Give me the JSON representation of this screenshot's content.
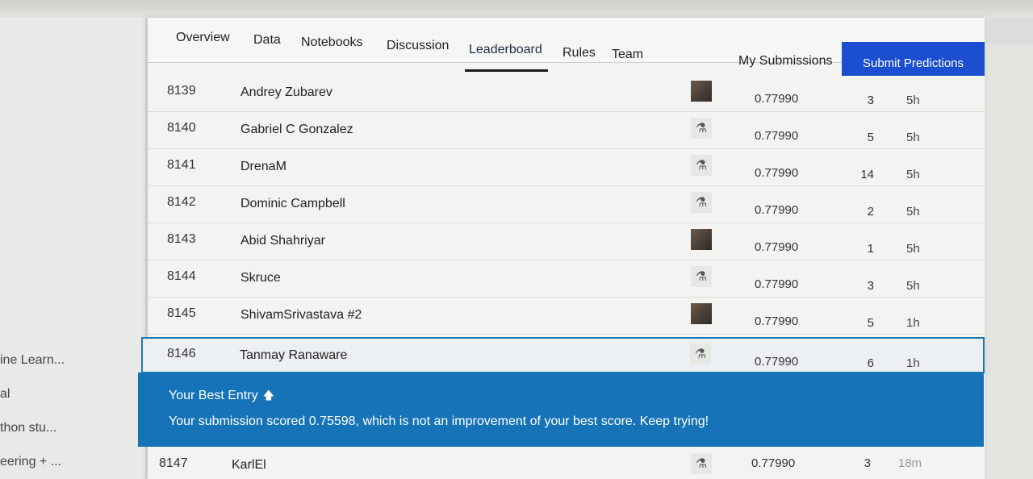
{
  "sidebar": {
    "items": [
      {
        "label": "ine Learn..."
      },
      {
        "label": "al"
      },
      {
        "label": "thon stu..."
      },
      {
        "label": "eering + ..."
      }
    ]
  },
  "tabs": [
    {
      "label": "Overview"
    },
    {
      "label": "Data"
    },
    {
      "label": "Notebooks"
    },
    {
      "label": "Discussion"
    },
    {
      "label": "Leaderboard",
      "active": true
    },
    {
      "label": "Rules"
    },
    {
      "label": "Team"
    }
  ],
  "header": {
    "my_submissions": "My Submissions",
    "submit_label": "Submit Predictions",
    "submit_color": "#1b4fcf"
  },
  "leaderboard": {
    "rows": [
      {
        "rank": "8139",
        "name": "Andrey Zubarev",
        "avatar": "photo",
        "score": "0.77990",
        "entries": "3",
        "last": "5h"
      },
      {
        "rank": "8140",
        "name": "Gabriel C Gonzalez",
        "avatar": "default",
        "score": "0.77990",
        "entries": "5",
        "last": "5h"
      },
      {
        "rank": "8141",
        "name": "DrenaM",
        "avatar": "default",
        "score": "0.77990",
        "entries": "14",
        "last": "5h"
      },
      {
        "rank": "8142",
        "name": "Dominic Campbell",
        "avatar": "default",
        "score": "0.77990",
        "entries": "2",
        "last": "5h"
      },
      {
        "rank": "8143",
        "name": "Abid Shahriyar",
        "avatar": "photo",
        "score": "0.77990",
        "entries": "1",
        "last": "5h"
      },
      {
        "rank": "8144",
        "name": "Skruce",
        "avatar": "default",
        "score": "0.77990",
        "entries": "3",
        "last": "5h"
      },
      {
        "rank": "8145",
        "name": "ShivamSrivastava #2",
        "avatar": "photo",
        "score": "0.77990",
        "entries": "5",
        "last": "1h"
      },
      {
        "rank": "8146",
        "name": "Tanmay Ranaware",
        "avatar": "default",
        "score": "0.77990",
        "entries": "6",
        "last": "1h",
        "highlight": true
      },
      {
        "rank": "8147",
        "name": "KarlEl",
        "avatar": "default",
        "score": "0.77990",
        "entries": "3",
        "last": "18m"
      }
    ]
  },
  "best_entry": {
    "title": "Your Best Entry",
    "icon": "arrow-up-icon",
    "message": "Your submission scored 0.75598, which is not an improvement of your best score. Keep trying!",
    "color": "#1673b8"
  }
}
